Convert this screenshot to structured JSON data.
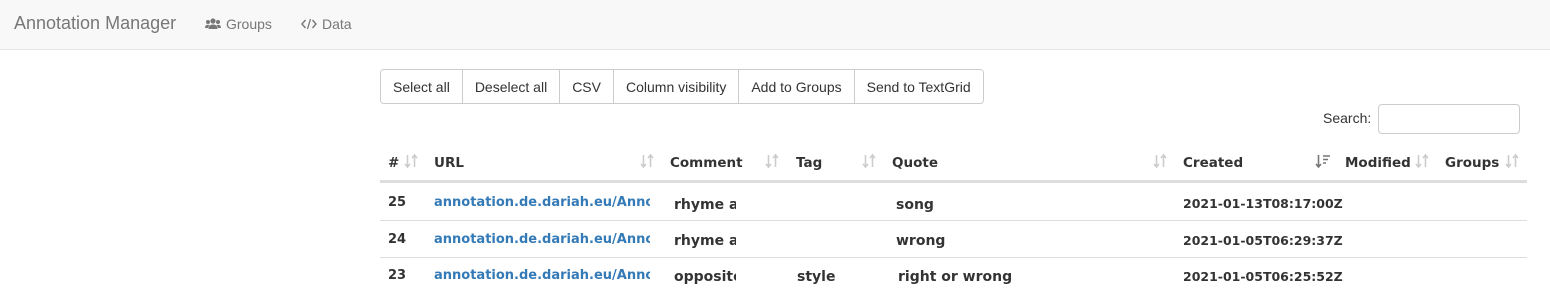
{
  "navbar": {
    "brand": "Annotation Manager",
    "links": [
      {
        "label": "Groups",
        "icon": "users-icon"
      },
      {
        "label": "Data",
        "icon": "code-icon"
      }
    ]
  },
  "toolbar": {
    "buttons": [
      "Select all",
      "Deselect all",
      "CSV",
      "Column visibility",
      "Add to Groups",
      "Send to TextGrid"
    ]
  },
  "search": {
    "label": "Search:",
    "value": ""
  },
  "table": {
    "columns": [
      "#",
      "URL",
      "Comment",
      "Tag",
      "Quote",
      "Created",
      "Modified",
      "Groups"
    ],
    "sorted_column": "Created",
    "sort_direction": "descending",
    "rows": [
      {
        "num": "25",
        "url": "annotation.de.dariah.eu/AnnotationViewer/data.html",
        "comment": "rhyme a",
        "tag": "",
        "quote": "song",
        "created": "2021-01-13T08:17:00Z",
        "modified": "",
        "groups": ""
      },
      {
        "num": "24",
        "url": "annotation.de.dariah.eu/AnnotationViewer/data.html",
        "comment": "rhyme a",
        "tag": "",
        "quote": "wrong",
        "created": "2021-01-05T06:29:37Z",
        "modified": "",
        "groups": ""
      },
      {
        "num": "23",
        "url": "annotation.de.dariah.eu/AnnotationViewer/data.html",
        "comment": "opposite",
        "tag": "style",
        "quote": "right or wrong",
        "created": "2021-01-05T06:25:52Z",
        "modified": "",
        "groups": ""
      }
    ]
  },
  "colors": {
    "link": "#337ab7",
    "navbar_bg": "#f8f8f8",
    "sort_icon": "#ccc",
    "active_sort_icon": "#888"
  }
}
